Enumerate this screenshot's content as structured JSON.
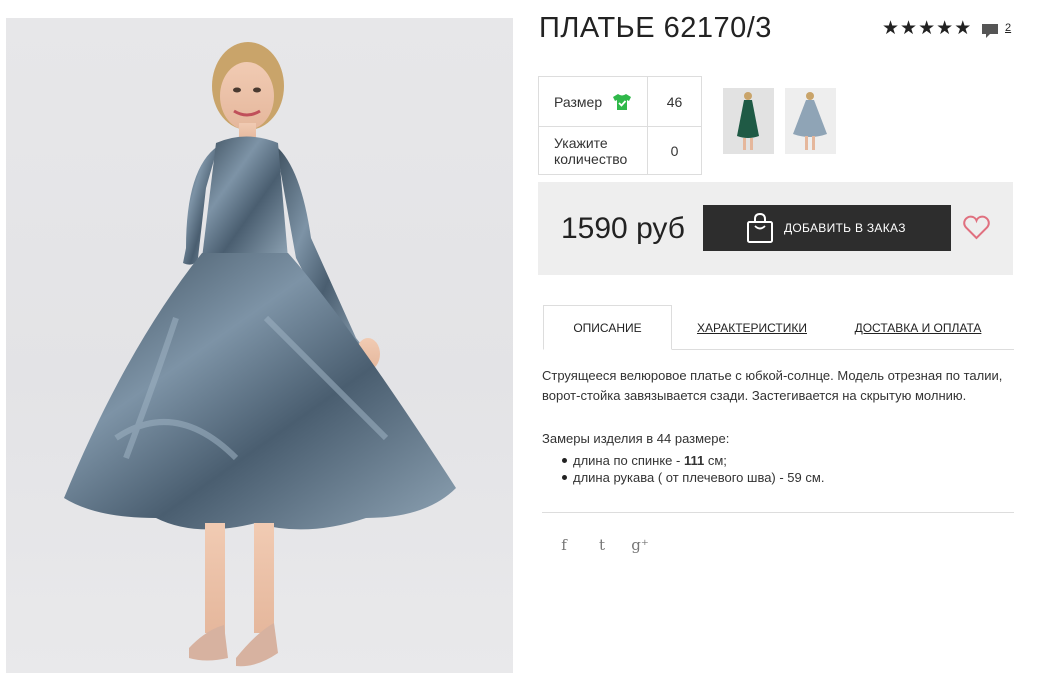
{
  "product": {
    "title": "ПЛАТЬЕ 62170/3",
    "rating_stars": [
      "★",
      "★",
      "★",
      "★",
      "★"
    ],
    "comments_count": "2"
  },
  "options": {
    "size_label": "Размер",
    "size_value": "46",
    "quantity_label": "Укажите количество",
    "quantity_value": "0"
  },
  "purchase": {
    "price": "1590 руб",
    "add_button_label": "ДОБАВИТЬ В ЗАКАЗ"
  },
  "tabs": [
    {
      "label": "ОПИСАНИЕ"
    },
    {
      "label": "ХАРАКТЕРИСТИКИ"
    },
    {
      "label": "ДОСТАВКА И ОПЛАТА"
    }
  ],
  "description": {
    "text": "Струящееся велюровое платье с юбкой-солнце. Модель отрезная по талии, ворот-стойка завязывается сзади. Застегивается на скрытую молнию.",
    "measures_title": "Замеры изделия в 44 размере:",
    "measures": [
      {
        "prefix": "длина по спинке - ",
        "bold": "111",
        "suffix": " см;"
      },
      {
        "prefix": "длина рукава ( от плечевого шва) - 59 см.",
        "bold": "",
        "suffix": ""
      }
    ]
  },
  "social": {
    "facebook": "f",
    "twitter": "t",
    "google_plus": "g⁺"
  },
  "colors": {
    "dark": "#2d2d2d",
    "accent_green": "#2fb84a",
    "heart": "#e0707f",
    "price_bar_bg": "#eeeeee"
  },
  "icons": {
    "size_chart": "tshirt-check-icon",
    "add_to_cart": "shopping-bag-icon",
    "favorite": "heart-icon",
    "comments": "speech-bubble-icon"
  }
}
